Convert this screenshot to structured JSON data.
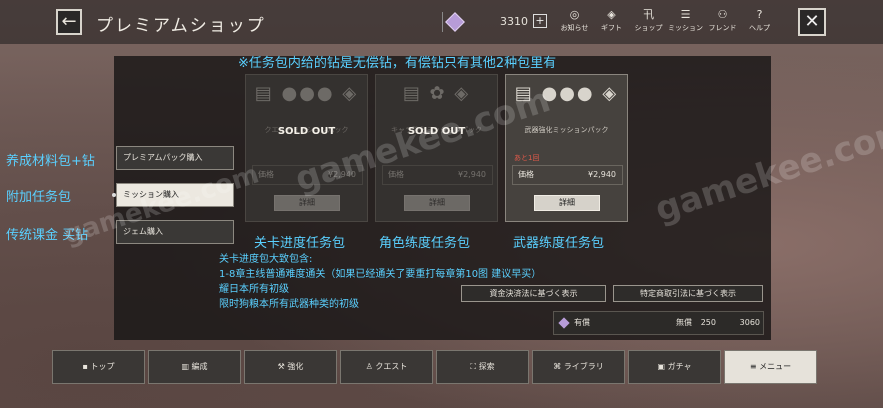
{
  "header": {
    "title": "プレミアムショップ",
    "back_icon": "←",
    "gem_count": "3310",
    "plus": "+",
    "nav": [
      {
        "icon": "◎",
        "label": "お知らせ"
      },
      {
        "icon": "◈",
        "label": "ギフト"
      },
      {
        "icon": "卂",
        "label": "ショップ"
      },
      {
        "icon": "☰",
        "label": "ミッション"
      },
      {
        "icon": "⚇",
        "label": "フレンド"
      },
      {
        "icon": "?",
        "label": "ヘルプ"
      }
    ],
    "close_icon": "✕"
  },
  "annotation_top": "※任务包内给的钻是无偿钻，有偿钻只有其他2种包里有",
  "menu": [
    {
      "label": "プレミアムパック購入",
      "note": "养成材料包+钻"
    },
    {
      "label": "ミッション購入",
      "note": "附加任务包"
    },
    {
      "label": "ジェム購入",
      "note": "传统课金 买钻"
    }
  ],
  "cards": [
    {
      "icon": "▤ ●●● ◈",
      "name": "クエストミッションパック",
      "status": "SOLD OUT",
      "limit": "",
      "price_label": "価格",
      "price": "¥2,940",
      "detail": "詳細",
      "caption": "关卡进度任务包"
    },
    {
      "icon": "▤ ✿ ◈",
      "name": "キャラ強化ミッションパック",
      "status": "SOLD OUT",
      "limit": "",
      "price_label": "価格",
      "price": "¥2,940",
      "detail": "詳細",
      "caption": "角色练度任务包"
    },
    {
      "icon": "▤ ●●● ◈",
      "name": "武器強化ミッションパック",
      "status": "",
      "limit": "あと1回",
      "price_label": "価格",
      "price": "¥2,940",
      "detail": "詳細",
      "caption": "武器练度任务包"
    }
  ],
  "notes": [
    "关卡进度包大致包含:",
    "1-8章主线普通难度通关（如果已经通关了要重打每章第10图 建议早买）",
    "耀日本所有初级",
    "限时狗粮本所有武器种类的初级"
  ],
  "legal": {
    "payment": "資金決済法に基づく表示",
    "commerce": "特定商取引法に基づく表示"
  },
  "balance": {
    "paid_label": "有償",
    "paid_value": "250",
    "free_label": "無償",
    "free_value": "3060"
  },
  "bottom_nav": [
    {
      "label": "▪ トップ"
    },
    {
      "label": "▥ 編成"
    },
    {
      "label": "⚒ 強化"
    },
    {
      "label": "♙ クエスト"
    },
    {
      "label": "⛶ 探索"
    },
    {
      "label": "⌘ ライブラリ"
    },
    {
      "label": "▣ ガチャ"
    },
    {
      "label": "≡ メニュー"
    }
  ],
  "watermark": [
    "gamekee.com",
    "gamekee.com",
    "gamekee.com"
  ]
}
